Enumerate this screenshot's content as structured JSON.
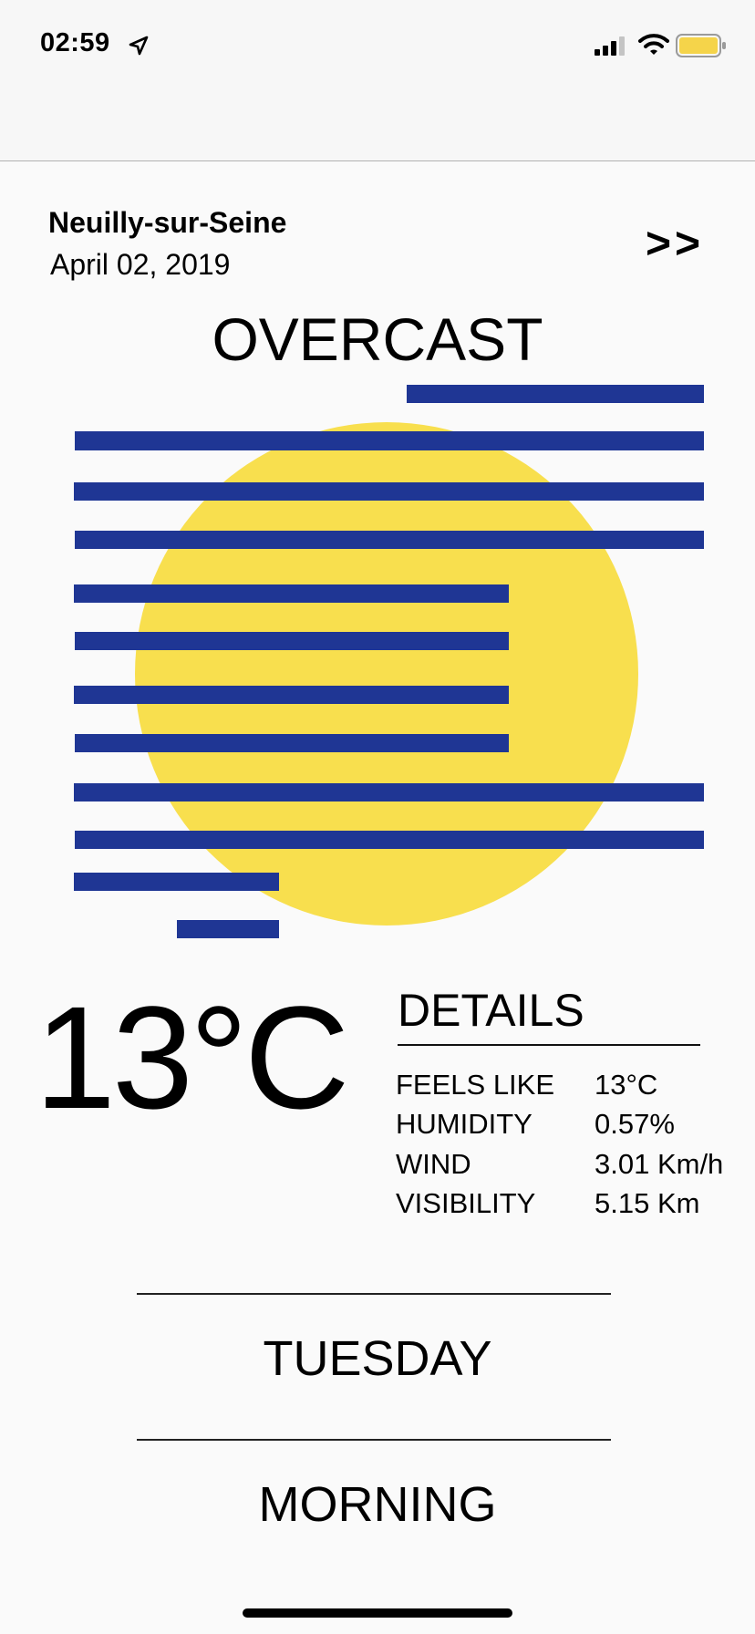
{
  "status_bar": {
    "time": "02:59",
    "icons": [
      "location-arrow-icon",
      "signal-bars-icon",
      "wifi-icon",
      "battery-icon"
    ],
    "battery_color": "#f5d44a"
  },
  "location": {
    "city": "Neuilly-sur-Seine",
    "date": "April 02, 2019"
  },
  "nav": {
    "next_label": ">>"
  },
  "condition": "OVERCAST",
  "illustration": {
    "sun_color": "#f8df4e",
    "cloud_line_color": "#1f3694"
  },
  "temperature": "13°C",
  "details": {
    "title": "DETAILS",
    "rows": [
      {
        "label": "FEELS LIKE",
        "value": "13°C"
      },
      {
        "label": "HUMIDITY",
        "value": "0.57%"
      },
      {
        "label": "WIND",
        "value": "3.01 Km/h"
      },
      {
        "label": "VISIBILITY",
        "value": "5.15 Km"
      }
    ]
  },
  "forecast": {
    "day": "TUESDAY",
    "period": "MORNING"
  }
}
